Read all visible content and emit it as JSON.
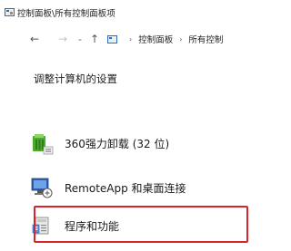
{
  "window": {
    "title": "控制面板\\所有控制面板项",
    "icon": "control-panel-icon"
  },
  "navigation": {
    "back_icon": "arrow-left-icon",
    "back_glyph": "←",
    "forward_icon": "arrow-right-icon",
    "forward_glyph": "→",
    "recent_icon": "chevron-down-icon",
    "recent_glyph": "⌄",
    "up_icon": "arrow-up-icon",
    "up_glyph": "↑",
    "address": {
      "separator": "›",
      "crumbs": [
        "控制面板",
        "所有控制"
      ]
    }
  },
  "main": {
    "heading": "调整计算机的设置",
    "items": [
      {
        "label": "360强力卸载 (32 位)",
        "icon": "uninstaller-icon"
      },
      {
        "label": "RemoteApp 和桌面连接",
        "icon": "remote-desktop-icon"
      },
      {
        "label": "程序和功能",
        "icon": "programs-features-icon",
        "highlighted": true
      }
    ]
  },
  "colors": {
    "highlight": "#d8232a",
    "accent": "#2a6fbd"
  }
}
